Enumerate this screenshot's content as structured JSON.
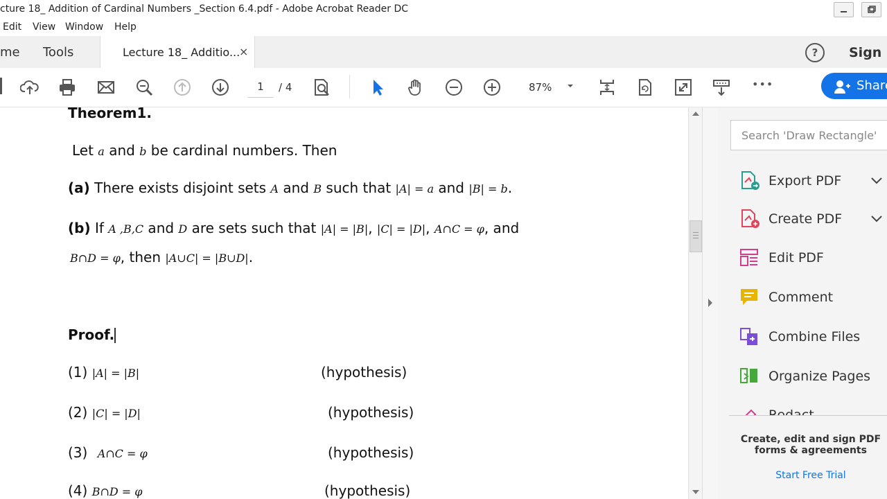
{
  "window": {
    "title": "cture 18_ Addition of Cardinal Numbers _Section 6.4.pdf - Adobe Acrobat Reader DC"
  },
  "menu": [
    "Edit",
    "View",
    "Window",
    "Help"
  ],
  "tabs": {
    "home": "me",
    "tools": "Tools",
    "active": "Lecture 18_ Additio...",
    "close": "×",
    "help": "?",
    "sign_in": "Sign I"
  },
  "toolbar": {
    "page_current": "1",
    "page_total": "/ 4",
    "zoom": "87%",
    "share": "Share",
    "more": "•••"
  },
  "document": {
    "heading": "Theorem1.",
    "let_pre": "Let ",
    "let_a": "a",
    "let_and": " and ",
    "let_b": "b",
    "let_post": " be cardinal numbers. Then",
    "a_label": "(a)",
    "a_text1": " There exists disjoint sets ",
    "a_A": "A",
    "a_and": " and ",
    "a_B": "B",
    "a_text2": " such that ",
    "a_eq1": "|A| = a",
    "a_and2": " and ",
    "a_eq2": "|B| = b",
    "a_dot": ".",
    "b_label": "(b)",
    "b_if": " If ",
    "b_sets": "A ,B,C",
    "b_and": " and ",
    "b_D": "D",
    "b_text": " are sets such that ",
    "b_eq1": "|A| = |B|",
    "b_comma1": ", ",
    "b_eq2": "|C| = |D|",
    "b_comma2": ", ",
    "b_eq3": "A∩C = φ",
    "b_and2": ", and",
    "b2_eq1": "B∩D = φ",
    "b2_then": ", then ",
    "b2_eq2": "|A∪C| = |B∪D|",
    "b2_dot": ".",
    "proof": "Proof.",
    "steps": [
      {
        "num": "(1)",
        "expr": "|A| = |B|",
        "reason": "(hypothesis)"
      },
      {
        "num": "(2)",
        "expr": "|C| = |D|",
        "reason": "(hypothesis)"
      },
      {
        "num": "(3)",
        "expr": "A∩C = φ",
        "reason": "(hypothesis)"
      },
      {
        "num": "(4)",
        "expr": "B∩D = φ",
        "reason": "(hypothesis)"
      }
    ]
  },
  "pane": {
    "search_placeholder": "Search 'Draw Rectangle'",
    "tools": [
      {
        "label": "Export PDF"
      },
      {
        "label": "Create PDF"
      },
      {
        "label": "Edit PDF"
      },
      {
        "label": "Comment"
      },
      {
        "label": "Combine Files"
      },
      {
        "label": "Organize Pages"
      },
      {
        "label": "Redact"
      }
    ],
    "promo_line1": "Create, edit and sign PDF",
    "promo_line2": "forms & agreements",
    "trial": "Start Free Trial"
  },
  "colors": {
    "accent": "#1473e6",
    "export": "#2a9d8f",
    "create": "#e0455b",
    "edit": "#d43c8c",
    "comment": "#e8b400",
    "combine": "#7a4fd6",
    "organize": "#46a83b",
    "redact": "#d43c8c"
  }
}
